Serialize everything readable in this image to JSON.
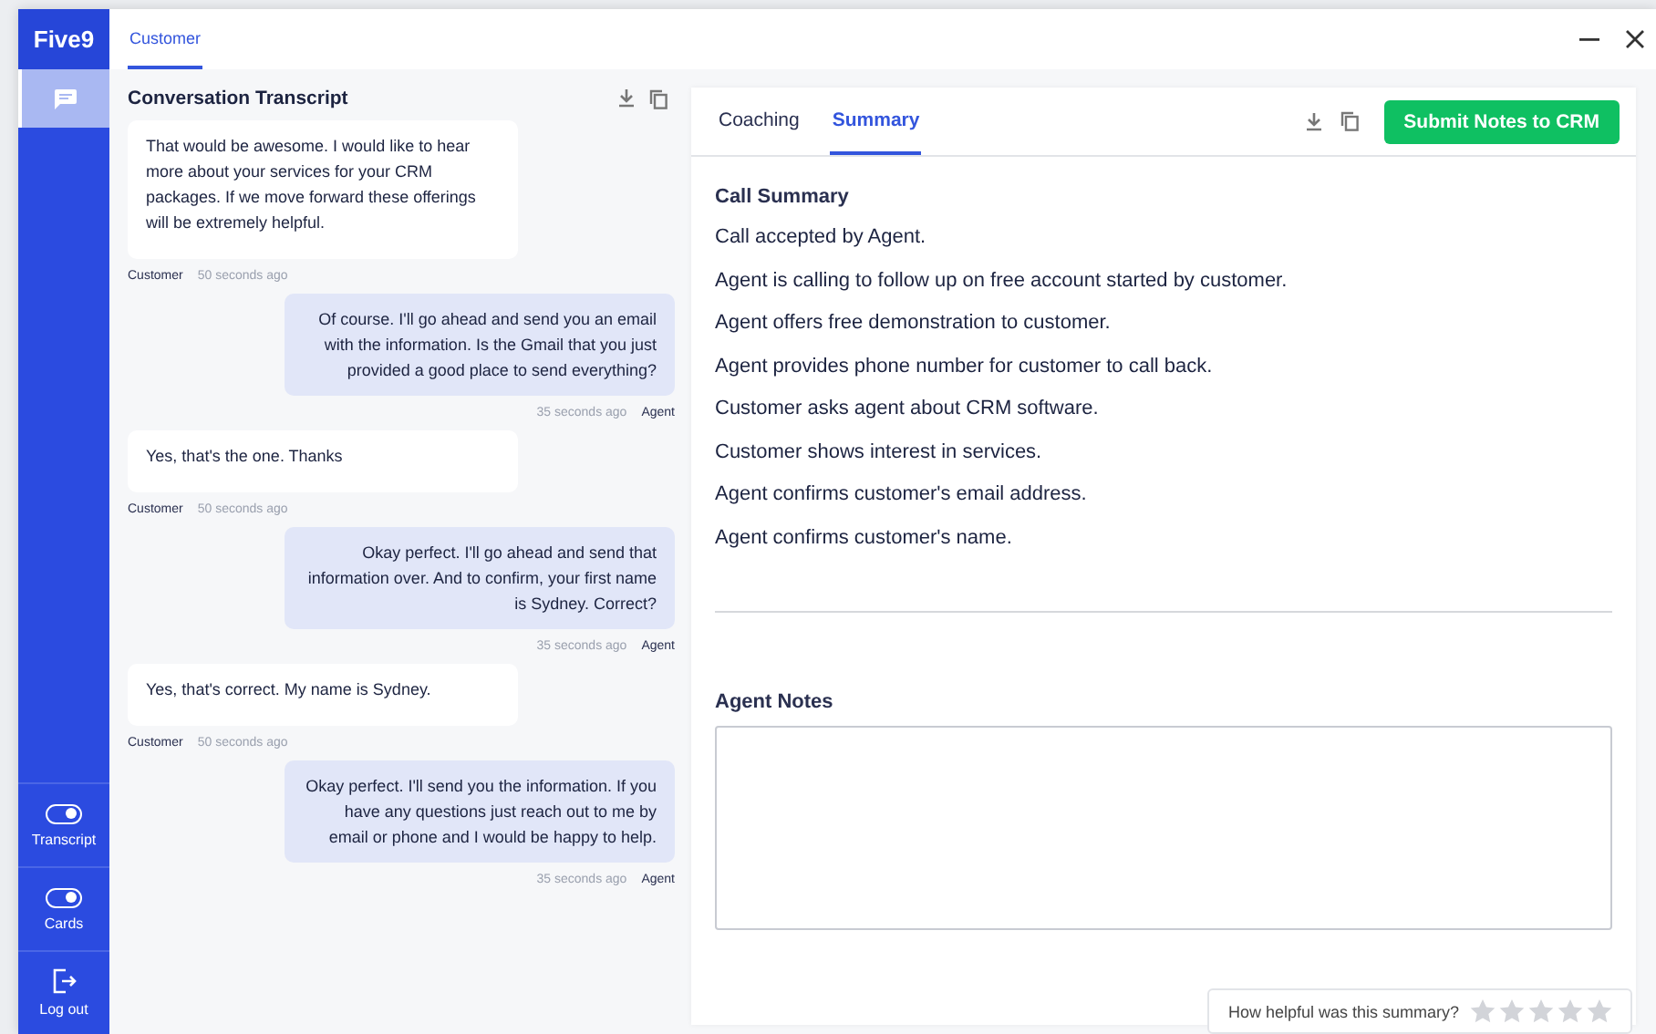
{
  "logo": "Five9",
  "sidebar": {
    "items": [
      {
        "kind": "chat",
        "selected": true
      }
    ],
    "bottom_items": [
      {
        "kind": "toggle",
        "label": "Transcript",
        "on": true
      },
      {
        "kind": "toggle",
        "label": "Cards",
        "on": true
      },
      {
        "kind": "logout",
        "label": "Log out"
      }
    ]
  },
  "top_tabs": [
    {
      "label": "Customer",
      "selected": true
    }
  ],
  "transcript": {
    "title": "Conversation Transcript",
    "messages": [
      {
        "sender": "Customer",
        "from_agent": false,
        "text": "That would be awesome. I would like to hear more about your services for your CRM packages. If we move forward these offerings will be extremely helpful.",
        "time": "50 seconds ago"
      },
      {
        "sender": "Agent",
        "from_agent": true,
        "text": "Of course. I'll go ahead and send you an email with the information. Is the Gmail that you just provided a good place to send everything?",
        "time": "35 seconds ago"
      },
      {
        "sender": "Customer",
        "from_agent": false,
        "text": "Yes, that's the one. Thanks",
        "time": "50 seconds ago"
      },
      {
        "sender": "Agent",
        "from_agent": true,
        "text": "Okay perfect. I'll go ahead and send that information over. And to confirm, your first name is Sydney. Correct?",
        "time": "35 seconds ago"
      },
      {
        "sender": "Customer",
        "from_agent": false,
        "text": "Yes, that's correct. My name is Sydney.",
        "time": "50 seconds ago"
      },
      {
        "sender": "Agent",
        "from_agent": true,
        "text": "Okay perfect. I'll send you the information. If you have any questions just reach out to me by email or phone and I would be happy to help.",
        "time": "35 seconds ago"
      }
    ]
  },
  "panel_tabs": [
    {
      "label": "Coaching",
      "selected": false
    },
    {
      "label": "Summary",
      "selected": true
    }
  ],
  "submit_button": "Submit Notes to CRM",
  "summary": {
    "title": "Call Summary",
    "items": [
      "Call accepted by Agent.",
      "Agent is calling to follow up on free account started by customer.",
      "Agent offers free demonstration to customer.",
      "Agent provides phone number for customer to call back.",
      "Customer asks agent about CRM software.",
      "Customer shows interest in services.",
      "Agent confirms customer's email address.",
      "Agent confirms customer's name."
    ]
  },
  "notes": {
    "label": "Agent Notes"
  },
  "rating": {
    "question": "How helpful was this summary?",
    "stars": 0
  }
}
